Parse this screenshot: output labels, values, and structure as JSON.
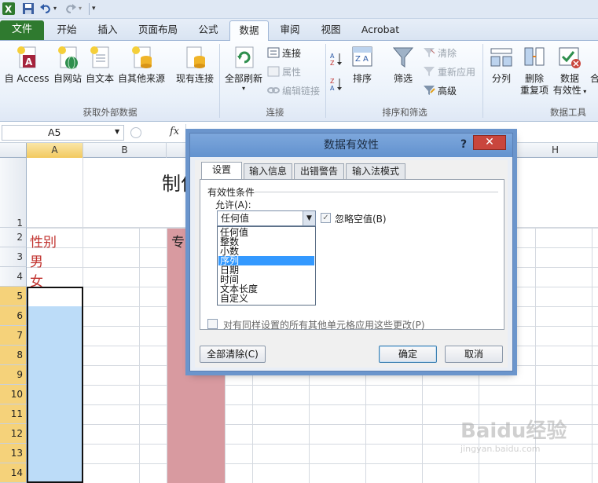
{
  "quick_access": {
    "icons": [
      "excel-logo-icon",
      "save-icon",
      "undo-icon",
      "redo-icon",
      "customize-qat-icon"
    ]
  },
  "tabs": [
    "文件",
    "开始",
    "插入",
    "页面布局",
    "公式",
    "数据",
    "审阅",
    "视图",
    "Acrobat"
  ],
  "active_tab": "数据",
  "ribbon": {
    "get_external": {
      "label": "获取外部数据",
      "buttons": [
        "自 Access",
        "自网站",
        "自文本",
        "自其他来源",
        "现有连接"
      ]
    },
    "connections": {
      "label": "连接",
      "refresh_all": "全部刷新",
      "items": [
        "连接",
        "属性",
        "编辑链接"
      ]
    },
    "sort_filter": {
      "label": "排序和筛选",
      "sort": "排序",
      "filter": "筛选",
      "items": [
        "清除",
        "重新应用",
        "高级"
      ]
    },
    "data_tools": {
      "label": "数据工具",
      "split": "分列",
      "remove_dup_1": "删除",
      "remove_dup_2": "重复项",
      "validation_1": "数据",
      "validation_2": "有效性",
      "more": "合"
    }
  },
  "formula_bar": {
    "name_box": "A5",
    "fx": "fx"
  },
  "sheet": {
    "columns": [
      "A",
      "B",
      "H"
    ],
    "rows": [
      "1",
      "2",
      "3",
      "4",
      "5",
      "6",
      "7",
      "8",
      "9",
      "10",
      "11",
      "12",
      "13",
      "14"
    ],
    "cells": {
      "A2": "性别",
      "A3": "男",
      "A4": "女",
      "title_fragment": "制作",
      "specialty_fragment": "专业"
    },
    "colors": {
      "selection_blue": "#bcdcf8",
      "column_fill_red": "#d89aa0",
      "text_red": "#c0302c"
    }
  },
  "dialog": {
    "title": "数据有效性",
    "help": "?",
    "close": "✕",
    "tabs": [
      "设置",
      "输入信息",
      "出错警告",
      "输入法模式"
    ],
    "section_title": "有效性条件",
    "allow_label": "允许(A):",
    "allow_value": "任何值",
    "ignore_blank": "忽略空值(B)",
    "options": [
      "任何值",
      "整数",
      "小数",
      "序列",
      "日期",
      "时间",
      "文本长度",
      "自定义"
    ],
    "selected_option": "序列",
    "apply_all": "对有同样设置的所有其他单元格应用这些更改(P)",
    "clear_all": "全部清除(C)",
    "ok": "确定",
    "cancel": "取消"
  },
  "watermark": {
    "text": "Baidu经验",
    "subtext": "jingyan.baidu.com"
  }
}
